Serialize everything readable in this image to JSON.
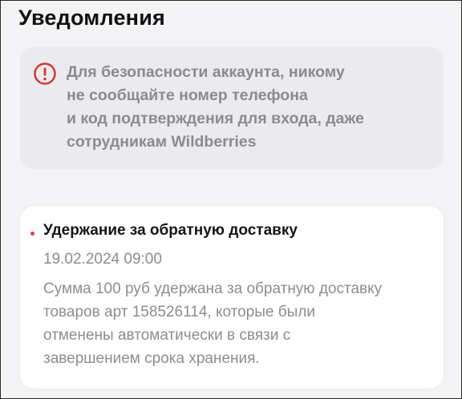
{
  "header": {
    "title": "Уведомления"
  },
  "notice": {
    "icon": "exclamation-circle-icon",
    "icon_color": "#d0352f",
    "text": "Для безопасности аккаунта, никому\nне сообщайте номер телефона\nи код подтверждения для входа, даже\nсотрудникам Wildberries"
  },
  "notifications": [
    {
      "title": "Удержание за обратную доставку",
      "date": "19.02.2024 09:00",
      "body": "Сумма 100 руб удержана за обратную доставку\nтоваров арт 158526114, которые были\nотменены автоматически в связи с\nзавершением срока хранения.",
      "unread": true,
      "unread_color": "#d9453b"
    }
  ]
}
